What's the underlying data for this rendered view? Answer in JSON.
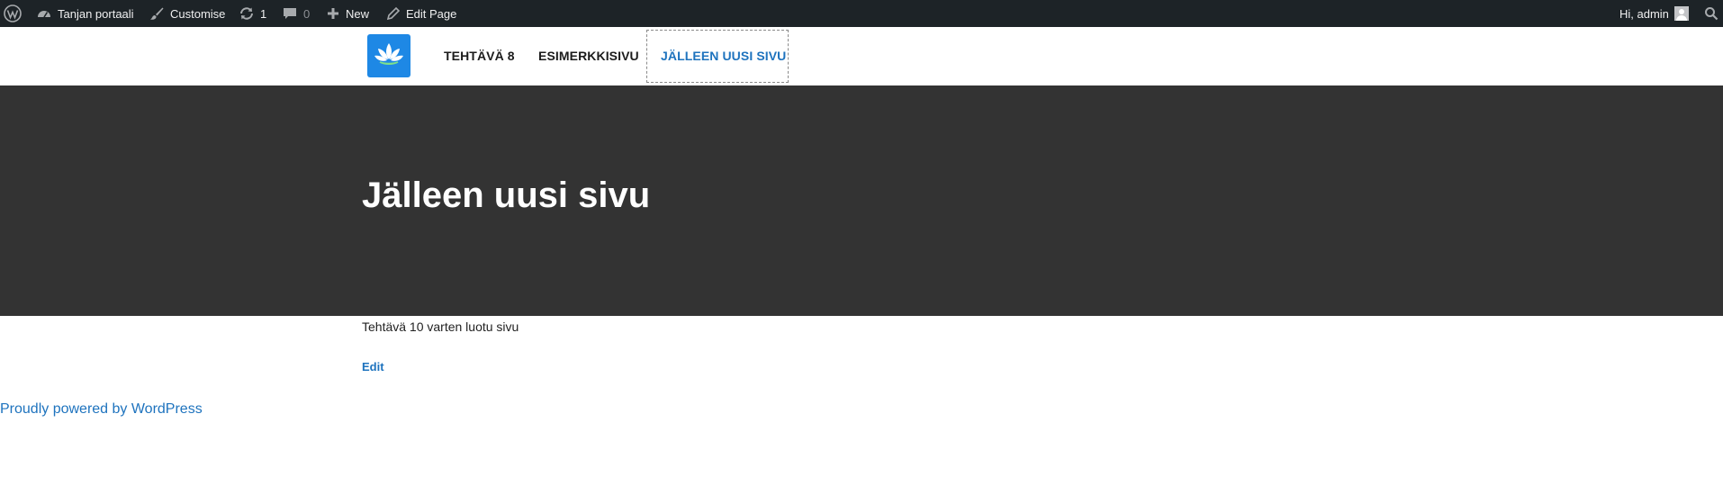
{
  "adminbar": {
    "site_name": "Tanjan portaali",
    "customise": "Customise",
    "updates_count": "1",
    "comments_count": "0",
    "new": "New",
    "edit_page": "Edit Page",
    "greeting": "Hi, admin",
    "icons": [
      "wordpress-logo-icon",
      "dashboard-icon",
      "brush-icon",
      "updates-icon",
      "comment-icon",
      "plus-icon",
      "pencil-icon",
      "avatar",
      "search-icon"
    ]
  },
  "header": {
    "nav": [
      {
        "label": "TEHTÄVÄ 8"
      },
      {
        "label": "ESIMERKKISIVU"
      },
      {
        "label": "JÄLLEEN UUSI SIVU"
      }
    ],
    "logo_icon": "lotus-icon"
  },
  "page": {
    "title": "Jälleen uusi sivu",
    "body": "Tehtävä 10 varten luotu sivu",
    "edit_label": "Edit"
  },
  "footer": {
    "credit": "Proudly powered by WordPress"
  },
  "colors": {
    "adminbar_bg": "#1d2327",
    "hero_bg": "#333333",
    "accent": "#1e73be",
    "logo_bg": "#1e88e5"
  }
}
